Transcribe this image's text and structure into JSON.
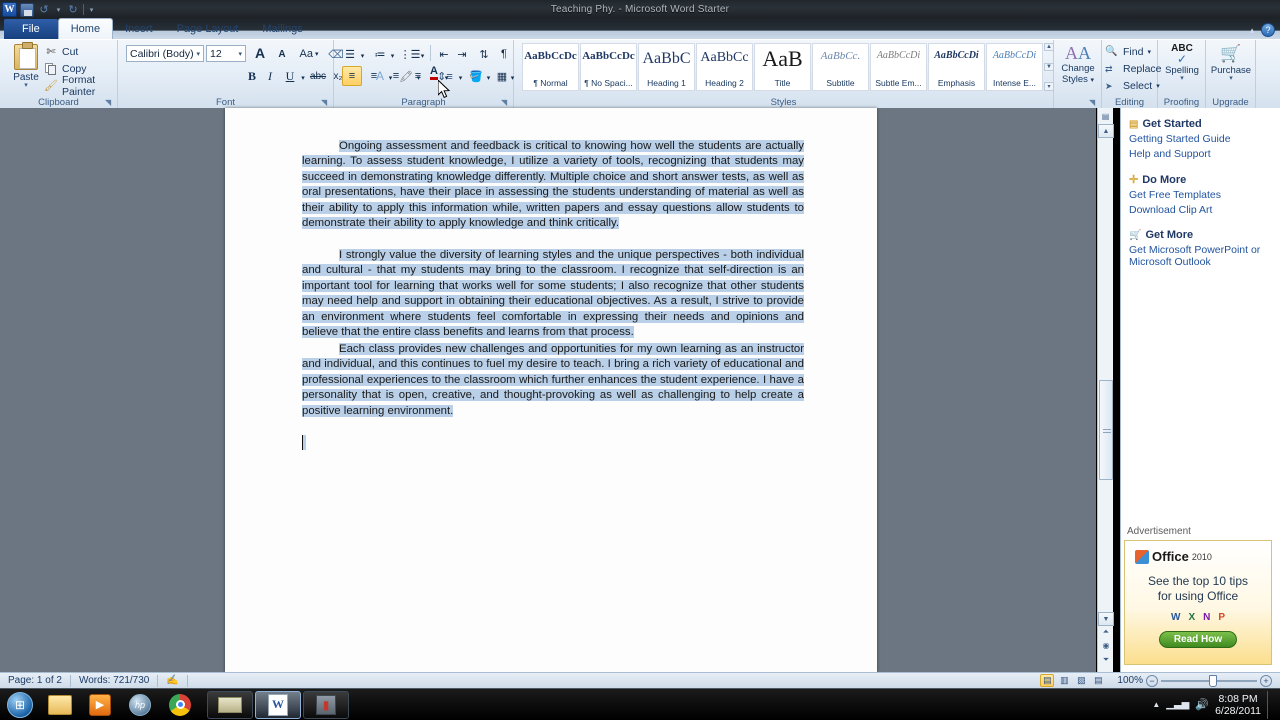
{
  "window": {
    "title": "Teaching Phy. - Microsoft Word Starter",
    "app_logo": "W"
  },
  "quick_access": {
    "save_icon": "save-icon",
    "undo_icon": "undo-icon",
    "redo_icon": "redo-icon",
    "customize_icon": "customize-qat-icon"
  },
  "tabs": [
    {
      "label": "File",
      "id": "file"
    },
    {
      "label": "Home",
      "id": "home"
    },
    {
      "label": "Insert",
      "id": "insert"
    },
    {
      "label": "Page Layout",
      "id": "page-layout"
    },
    {
      "label": "Mailings",
      "id": "mailings"
    }
  ],
  "active_tab": "Home",
  "help_button": "?",
  "ribbon": {
    "clipboard": {
      "label": "Clipboard",
      "paste": "Paste",
      "cut": "Cut",
      "copy": "Copy",
      "format_painter": "Format Painter"
    },
    "font": {
      "label": "Font",
      "font_name": "Calibri (Body)",
      "font_size": "12",
      "grow_font": "A",
      "shrink_font": "A",
      "change_case": "Aa",
      "clear_formatting": "clear-formatting-icon",
      "bold": "B",
      "italic": "I",
      "underline": "U",
      "strikethrough": "abc",
      "subscript": "x₂",
      "superscript": "x²",
      "text_effects": "A",
      "highlight": "highlight-icon",
      "font_color": "A"
    },
    "paragraph": {
      "label": "Paragraph",
      "bullets": "bullets-icon",
      "numbering": "numbering-icon",
      "multilevel": "multilevel-list-icon",
      "decrease_indent": "decrease-indent-icon",
      "increase_indent": "increase-indent-icon",
      "sort": "sort-icon",
      "show_marks": "¶",
      "align_left": "align-left-icon",
      "align_center": "align-center-icon",
      "align_right": "align-right-icon",
      "justify": "justify-icon",
      "line_spacing": "line-spacing-icon",
      "shading": "shading-icon",
      "borders": "borders-icon"
    },
    "styles": {
      "label": "Styles",
      "items": [
        {
          "preview": "AaBbCcDc",
          "name": "¶ Normal"
        },
        {
          "preview": "AaBbCcDc",
          "name": "¶ No Spaci..."
        },
        {
          "preview": "AaBbC",
          "name": "Heading 1"
        },
        {
          "preview": "AaBbCc",
          "name": "Heading 2"
        },
        {
          "preview": "AaB",
          "name": "Title"
        },
        {
          "preview": "AaBbCc.",
          "name": "Subtitle"
        },
        {
          "preview": "AaBbCcDi",
          "name": "Subtle Em..."
        },
        {
          "preview": "AaBbCcDi",
          "name": "Emphasis"
        },
        {
          "preview": "AaBbCcDi",
          "name": "Intense E..."
        }
      ],
      "change_styles": "Change Styles"
    },
    "editing": {
      "label": "Editing",
      "find": "Find",
      "replace": "Replace",
      "select": "Select"
    },
    "proofing": {
      "label": "Proofing",
      "spelling": "Spelling",
      "badge": "ABC"
    },
    "upgrade": {
      "label": "Upgrade",
      "purchase": "Purchase"
    }
  },
  "document": {
    "paragraphs": [
      "Ongoing assessment and feedback is critical to knowing how well the students are actually learning. To assess student knowledge, I utilize a variety of tools, recognizing that students may succeed in demonstrating knowledge differently. Multiple choice and short answer tests, as well as oral presentations, have their place in assessing the students understanding of material as well as their ability to apply this information while, written papers and essay questions allow students to demonstrate their ability to apply knowledge and think critically.",
      "I strongly value the diversity of learning styles and the unique perspectives - both individual and cultural - that my students may bring to the classroom. I recognize that self-direction is an important tool for learning that works well for some students; I also recognize that other students may need help and support in obtaining their educational objectives. As a result, I strive to provide an environment where students feel comfortable in expressing their needs and opinions and believe that the entire class benefits and learns from that process.",
      "Each class provides new challenges and opportunities for my own learning as an instructor and individual, and this continues to fuel my desire to teach. I bring a rich variety of educational and professional experiences to the classroom which further enhances the student experience. I have a personality that is open, creative, and thought-provoking as well as challenging to help create a positive learning environment."
    ],
    "selection_color": "#b9d0e8"
  },
  "right_panel": {
    "sections": [
      {
        "heading": "Get Started",
        "icon": "book-icon",
        "links": [
          "Getting Started Guide",
          "Help and Support"
        ]
      },
      {
        "heading": "Do More",
        "icon": "plus-icon",
        "links": [
          "Get Free Templates",
          "Download Clip Art"
        ]
      },
      {
        "heading": "Get More",
        "icon": "cart-icon",
        "links": [
          "Get Microsoft PowerPoint or Microsoft Outlook"
        ]
      }
    ],
    "advertisement": {
      "label": "Advertisement",
      "brand": "Office",
      "brand_year": "2010",
      "headline_line1": "See the top 10 tips",
      "headline_line2": "for using Office",
      "app_icons": [
        "W",
        "X",
        "N",
        "P"
      ],
      "cta": "Read How"
    }
  },
  "status_bar": {
    "page": "Page: 1 of 2",
    "words": "Words: 721/730",
    "proof_icon": "proofing-status-icon",
    "views": [
      "print-layout-view",
      "full-screen-reading-view",
      "web-layout-view",
      "draft-view"
    ],
    "active_view": "print-layout-view",
    "zoom": "100%",
    "zoom_out": "−",
    "zoom_in": "+"
  },
  "taskbar": {
    "start": "start-orb",
    "pinned": [
      "explorer-icon",
      "media-player-icon",
      "hp-icon",
      "chrome-icon"
    ],
    "running": [
      "mail-window",
      "word-window",
      "wine-window"
    ],
    "tray": [
      "show-hidden-icon",
      "network-icon",
      "volume-icon"
    ],
    "clock_time": "8:08 PM",
    "clock_date": "6/28/2011"
  },
  "colors": {
    "accent": "#ffcf62",
    "selection": "#b9d0e8",
    "ribbon_bg": "#e3ecf6",
    "link": "#2254a0",
    "heading": "#1f3864"
  }
}
